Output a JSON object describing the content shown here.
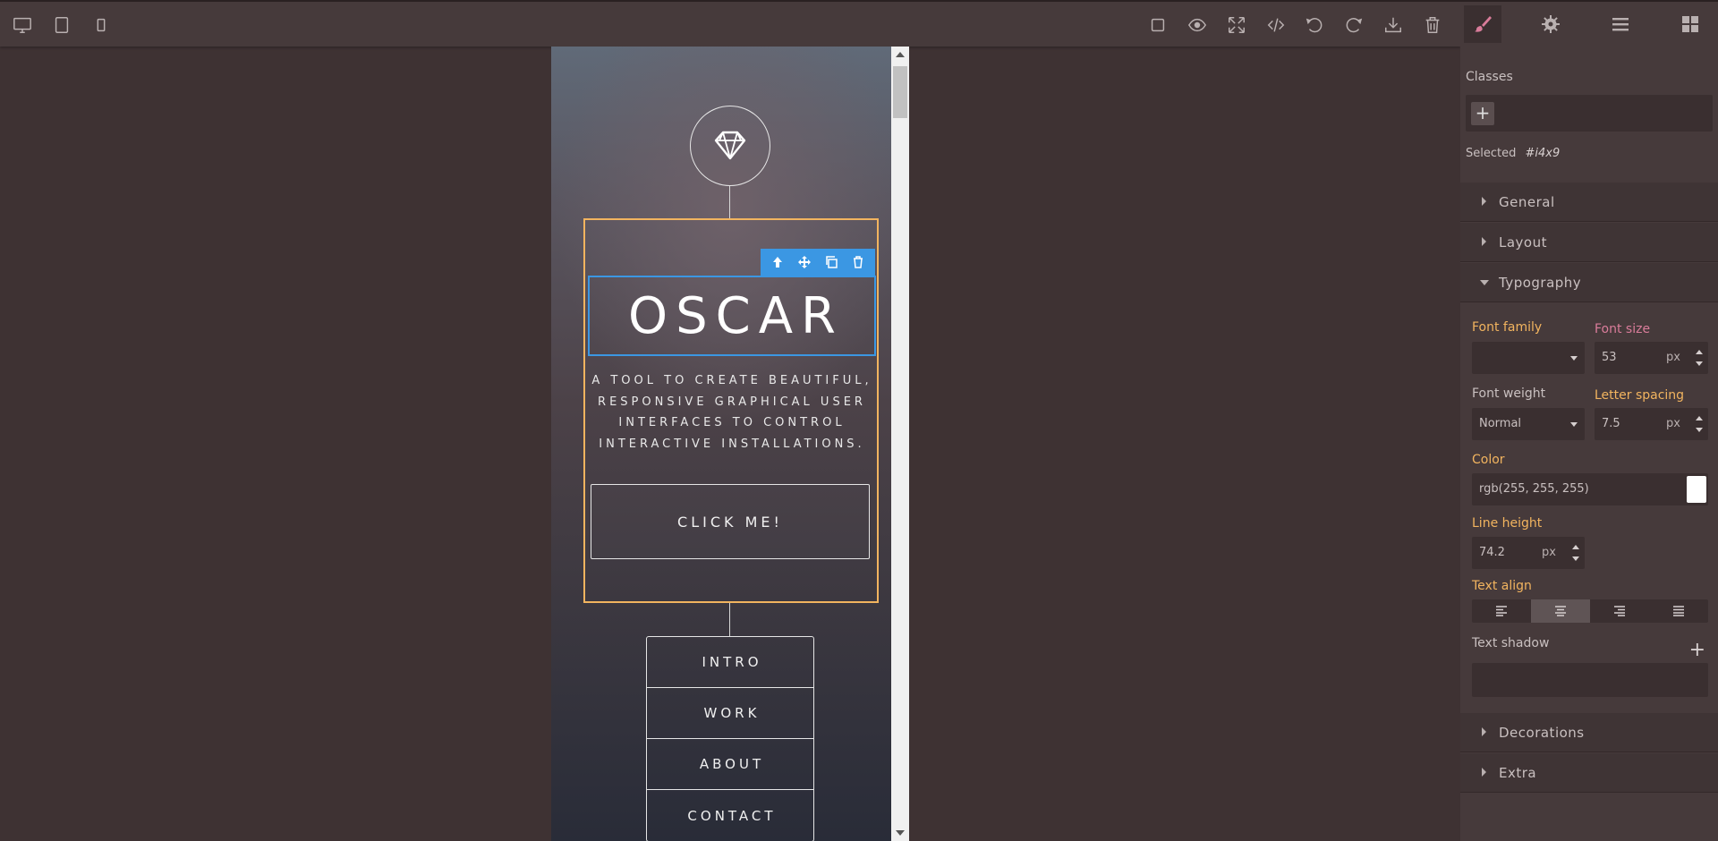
{
  "toolbar": {
    "devices": [
      "desktop-icon",
      "tablet-icon",
      "mobile-icon"
    ],
    "actions": [
      "square-icon",
      "eye-icon",
      "fullscreen-icon",
      "code-icon",
      "undo-icon",
      "redo-icon",
      "download-icon",
      "trash-icon"
    ]
  },
  "panel_tabs": [
    "paint-brush-icon",
    "gear-icon",
    "menu-icon",
    "blocks-icon"
  ],
  "accent_colors": {
    "active_tab": "#d97c9a",
    "label_orange": "#f2b45f",
    "selection_blue": "#3b97e3"
  },
  "classes": {
    "label": "Classes",
    "add": "+"
  },
  "selected": {
    "label": "Selected",
    "id": "#i4x9"
  },
  "sections": {
    "general": "General",
    "layout": "Layout",
    "typography": "Typography",
    "decorations": "Decorations",
    "extra": "Extra"
  },
  "typography": {
    "font_family": {
      "label": "Font family",
      "value": ""
    },
    "font_size": {
      "label": "Font size",
      "value": "53",
      "unit": "px"
    },
    "font_weight": {
      "label": "Font weight",
      "value": "Normal"
    },
    "letter_spacing": {
      "label": "Letter spacing",
      "value": "7.5",
      "unit": "px"
    },
    "color": {
      "label": "Color",
      "value": "rgb(255, 255, 255)"
    },
    "line_height": {
      "label": "Line height",
      "value": "74.2",
      "unit": "px"
    },
    "text_align": {
      "label": "Text align",
      "options": [
        "left",
        "center",
        "right",
        "justify"
      ],
      "selected": "center"
    },
    "text_shadow": {
      "label": "Text shadow",
      "add": "+"
    }
  },
  "canvas": {
    "title": "OSCAR",
    "subtitle": "A TOOL TO CREATE BEAUTIFUL, RESPONSIVE GRAPHICAL USER INTERFACES TO CONTROL INTERACTIVE INSTALLATIONS.",
    "button": "CLICK ME!",
    "nav": [
      "INTRO",
      "WORK",
      "ABOUT",
      "CONTACT"
    ],
    "element_toolbar": [
      "arrow-up-icon",
      "move-icon",
      "copy-icon",
      "delete-icon"
    ]
  }
}
